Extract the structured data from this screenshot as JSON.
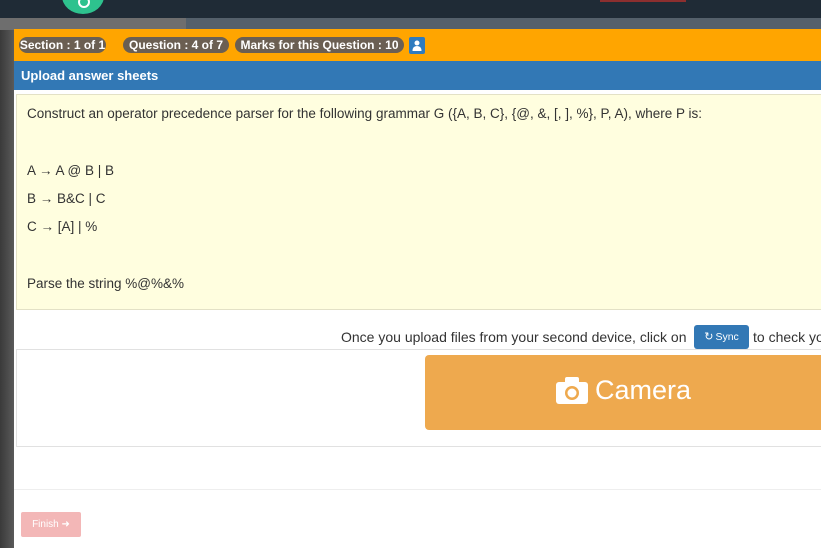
{
  "header": {
    "section": "Section : 1 of 1",
    "question": "Question : 4 of 7",
    "marks": "Marks for this Question : 10",
    "user_icon": "user-icon"
  },
  "title": "Upload answer sheets",
  "question": {
    "lines": [
      "Construct an operator precedence parser for the following grammar G ({A, B, C}, {@, &, [, ], %}, P, A), where P is:",
      "A → A @ B | B",
      "B → B&C | C",
      "C → [A] | %",
      "Parse the string %@%&%"
    ]
  },
  "sync": {
    "before": "Once you upload files from your second device, click on",
    "button": "Sync",
    "after": "to check yo",
    "icon": "refresh-icon"
  },
  "camera": {
    "label": "Camera",
    "icon": "camera-icon"
  },
  "finish": {
    "label": "Finish",
    "icon": "sign-out-icon"
  },
  "colors": {
    "header_orange": "#ffa500",
    "title_blue": "#3278b5",
    "question_bg": "#fffedf",
    "camera_orange": "#eea94e",
    "finish_pink": "#f3b7b7"
  }
}
